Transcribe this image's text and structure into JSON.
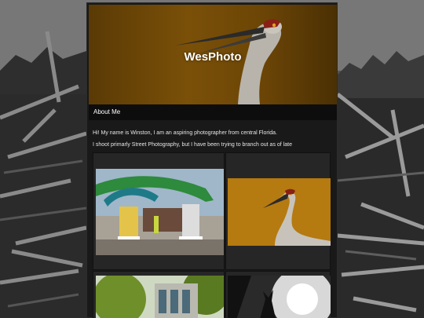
{
  "site": {
    "title": "WesPhoto"
  },
  "nav": {
    "about_label": "About Me"
  },
  "intro": {
    "line1": "Hi! My name is Winston, I am an aspiring photographer from central Florida.",
    "line2": "I shoot primarly Street Photography, but I have been trying to branch out as of late"
  },
  "colors": {
    "header_accent": "#7a5008",
    "page_background": "#191919",
    "nav_background": "#0d0d0d"
  }
}
